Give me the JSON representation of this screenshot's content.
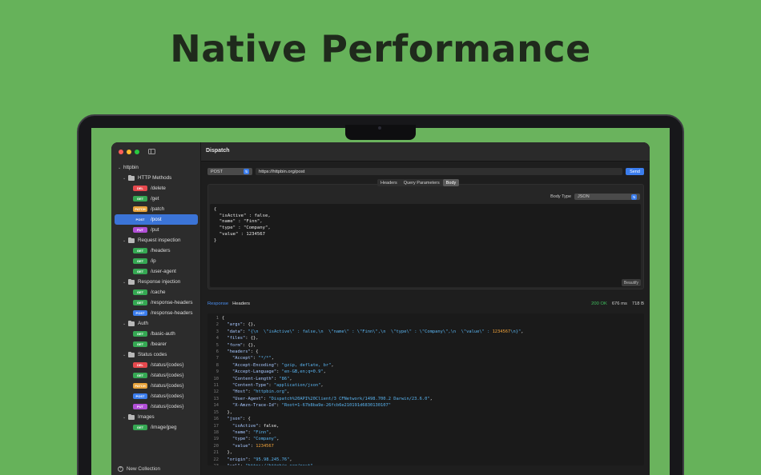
{
  "headline": "Native Performance",
  "window": {
    "title": "Dispatch"
  },
  "sidebar": {
    "items": [
      {
        "kind": "collection",
        "label": "httpbin"
      },
      {
        "kind": "folder",
        "label": "HTTP Methods"
      },
      {
        "kind": "request",
        "method": "DEL",
        "label": "/delete"
      },
      {
        "kind": "request",
        "method": "GET",
        "label": "/get"
      },
      {
        "kind": "request",
        "method": "PATCH",
        "label": "/patch"
      },
      {
        "kind": "request",
        "method": "POST",
        "label": "/post",
        "selected": true
      },
      {
        "kind": "request",
        "method": "PUT",
        "label": "/put"
      },
      {
        "kind": "folder",
        "label": "Request inspection"
      },
      {
        "kind": "request",
        "method": "GET",
        "label": "/headers"
      },
      {
        "kind": "request",
        "method": "GET",
        "label": "/ip"
      },
      {
        "kind": "request",
        "method": "GET",
        "label": "/user-agent"
      },
      {
        "kind": "folder",
        "label": "Response injection"
      },
      {
        "kind": "request",
        "method": "GET",
        "label": "/cache"
      },
      {
        "kind": "request",
        "method": "GET",
        "label": "/response-headers"
      },
      {
        "kind": "request",
        "method": "POST",
        "label": "/response-headers"
      },
      {
        "kind": "folder",
        "label": "Auth"
      },
      {
        "kind": "request",
        "method": "GET",
        "label": "/basic-auth"
      },
      {
        "kind": "request",
        "method": "GET",
        "label": "/bearer"
      },
      {
        "kind": "folder",
        "label": "Status codes"
      },
      {
        "kind": "request",
        "method": "DEL",
        "label": "/status/{codes}"
      },
      {
        "kind": "request",
        "method": "GET",
        "label": "/status/{codes}"
      },
      {
        "kind": "request",
        "method": "PATCH",
        "label": "/status/{codes}"
      },
      {
        "kind": "request",
        "method": "POST",
        "label": "/status/{codes}"
      },
      {
        "kind": "request",
        "method": "PUT",
        "label": "/status/{codes}"
      },
      {
        "kind": "folder",
        "label": "Images"
      },
      {
        "kind": "request",
        "method": "GET",
        "label": "/image/jpeg"
      }
    ],
    "new_collection": "New Collection"
  },
  "request": {
    "method": "POST",
    "url": "https://httpbin.org/post",
    "send": "Send",
    "tabs": [
      {
        "label": "Headers",
        "active": false
      },
      {
        "label": "Query Parameters",
        "active": false
      },
      {
        "label": "Body",
        "active": true
      }
    ],
    "body_type_label": "Body Type",
    "body_type": "JSON",
    "body_text": "{\n  \"isActive\" : false,\n  \"name\" : \"Finn\",\n  \"type\" : \"Company\",\n  \"value\" : 1234567\n}",
    "beautify": "Beautify"
  },
  "response": {
    "tabs": [
      "Response",
      "Headers"
    ],
    "status": "200 OK",
    "time": "676 ms",
    "size": "718 B",
    "lines": [
      [
        [
          "p",
          "{"
        ]
      ],
      [
        [
          "p",
          "  "
        ],
        [
          "k",
          "\"args\""
        ],
        [
          "p",
          ": {},"
        ]
      ],
      [
        [
          "p",
          "  "
        ],
        [
          "k",
          "\"data\""
        ],
        [
          "p",
          ": "
        ],
        [
          "s",
          "\"{\\n  \\\"isActive\\\" : false,\\n  \\\"name\\\" : \\\"Finn\\\",\\n  \\\"type\\\" : \\\"Company\\\",\\n  \\\"value\\\" : "
        ],
        [
          "n",
          "1234567"
        ],
        [
          "s",
          "\\n}\""
        ],
        [
          "p",
          ","
        ]
      ],
      [
        [
          "p",
          "  "
        ],
        [
          "k",
          "\"files\""
        ],
        [
          "p",
          ": {},"
        ]
      ],
      [
        [
          "p",
          "  "
        ],
        [
          "k",
          "\"form\""
        ],
        [
          "p",
          ": {},"
        ]
      ],
      [
        [
          "p",
          "  "
        ],
        [
          "k",
          "\"headers\""
        ],
        [
          "p",
          ": {"
        ]
      ],
      [
        [
          "p",
          "    "
        ],
        [
          "k",
          "\"Accept\""
        ],
        [
          "p",
          ": "
        ],
        [
          "s",
          "\"*/*\""
        ],
        [
          "p",
          ","
        ]
      ],
      [
        [
          "p",
          "    "
        ],
        [
          "k",
          "\"Accept-Encoding\""
        ],
        [
          "p",
          ": "
        ],
        [
          "s",
          "\"gzip, deflate, br\""
        ],
        [
          "p",
          ","
        ]
      ],
      [
        [
          "p",
          "    "
        ],
        [
          "k",
          "\"Accept-Language\""
        ],
        [
          "p",
          ": "
        ],
        [
          "s",
          "\"en-GB,en;q=0.9\""
        ],
        [
          "p",
          ","
        ]
      ],
      [
        [
          "p",
          "    "
        ],
        [
          "k",
          "\"Content-Length\""
        ],
        [
          "p",
          ": "
        ],
        [
          "s",
          "\"86\""
        ],
        [
          "p",
          ","
        ]
      ],
      [
        [
          "p",
          "    "
        ],
        [
          "k",
          "\"Content-Type\""
        ],
        [
          "p",
          ": "
        ],
        [
          "s",
          "\"application/json\""
        ],
        [
          "p",
          ","
        ]
      ],
      [
        [
          "p",
          "    "
        ],
        [
          "k",
          "\"Host\""
        ],
        [
          "p",
          ": "
        ],
        [
          "s",
          "\"httpbin.org\""
        ],
        [
          "p",
          ","
        ]
      ],
      [
        [
          "p",
          "    "
        ],
        [
          "k",
          "\"User-Agent\""
        ],
        [
          "p",
          ": "
        ],
        [
          "s",
          "\"Dispatch%20API%20Client/3 CFNetwork/1498.700.2 Darwin/23.6.0\""
        ],
        [
          "p",
          ","
        ]
      ],
      [
        [
          "p",
          "    "
        ],
        [
          "k",
          "\"X-Amzn-Trace-Id\""
        ],
        [
          "p",
          ": "
        ],
        [
          "s",
          "\"Root=1-67b8ba9e-26fcb6e210191d6830130107\""
        ]
      ],
      [
        [
          "p",
          "  },"
        ]
      ],
      [
        [
          "p",
          "  "
        ],
        [
          "k",
          "\"json\""
        ],
        [
          "p",
          ": {"
        ]
      ],
      [
        [
          "p",
          "    "
        ],
        [
          "k",
          "\"isActive\""
        ],
        [
          "p",
          ": false,"
        ]
      ],
      [
        [
          "p",
          "    "
        ],
        [
          "k",
          "\"name\""
        ],
        [
          "p",
          ": "
        ],
        [
          "s",
          "\"Finn\""
        ],
        [
          "p",
          ","
        ]
      ],
      [
        [
          "p",
          "    "
        ],
        [
          "k",
          "\"type\""
        ],
        [
          "p",
          ": "
        ],
        [
          "s",
          "\"Company\""
        ],
        [
          "p",
          ","
        ]
      ],
      [
        [
          "p",
          "    "
        ],
        [
          "k",
          "\"value\""
        ],
        [
          "p",
          ": "
        ],
        [
          "n",
          "1234567"
        ]
      ],
      [
        [
          "p",
          "  },"
        ]
      ],
      [
        [
          "p",
          "  "
        ],
        [
          "k",
          "\"origin\""
        ],
        [
          "p",
          ": "
        ],
        [
          "s",
          "\"95.98.245.76\""
        ],
        [
          "p",
          ","
        ]
      ],
      [
        [
          "p",
          "  "
        ],
        [
          "k",
          "\"url\""
        ],
        [
          "p",
          ": "
        ],
        [
          "s",
          "\"https://httpbin.org/post\""
        ]
      ]
    ]
  }
}
